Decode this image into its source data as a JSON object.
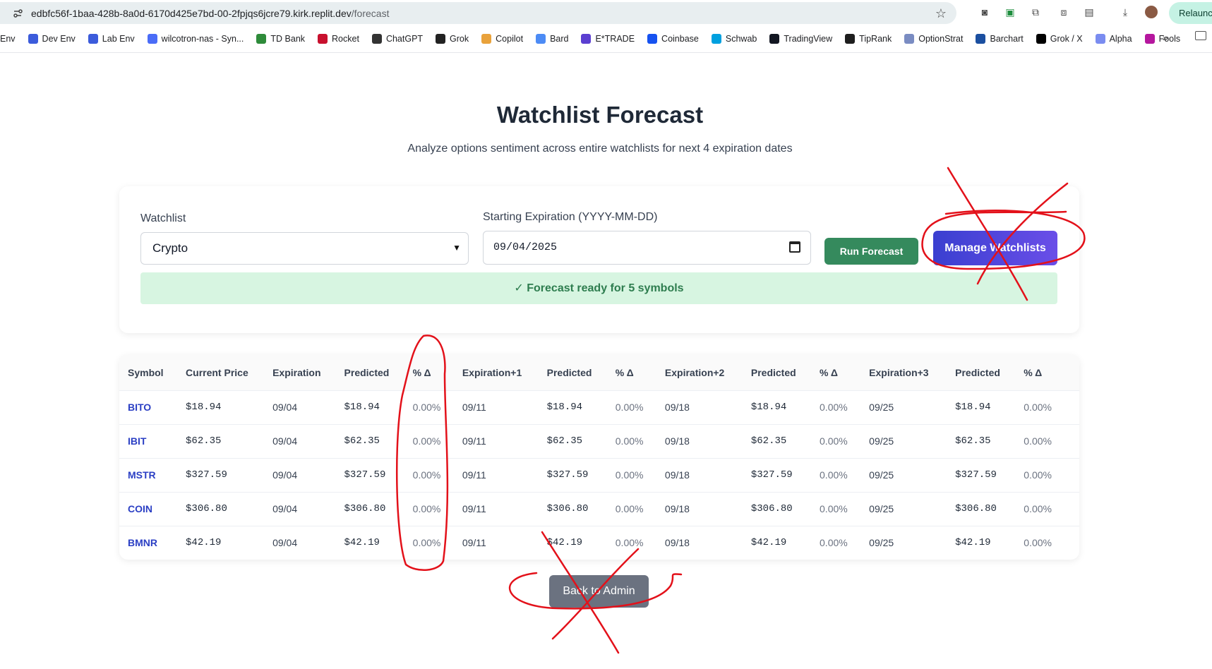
{
  "browser": {
    "url_host": "edbfc56f-1baa-428b-8a0d-6170d425e7bd-00-2fpjqs6jcre79.kirk.replit.dev",
    "url_path": "/forecast",
    "relaunch_label": "Relaunch"
  },
  "bookmarks": [
    {
      "label": "Env",
      "icon": "env-icon",
      "color": "#ffffff"
    },
    {
      "label": "Dev Env",
      "icon": "so-icon",
      "color": "#3b5bdb"
    },
    {
      "label": "Lab Env",
      "icon": "so-icon",
      "color": "#3b5bdb"
    },
    {
      "label": "wilcotron-nas - Syn...",
      "icon": "dsm-icon",
      "color": "#4a6cf7"
    },
    {
      "label": "TD Bank",
      "icon": "td-icon",
      "color": "#2e8b3a"
    },
    {
      "label": "Rocket",
      "icon": "rocket-icon",
      "color": "#c8102e"
    },
    {
      "label": "ChatGPT",
      "icon": "chatgpt-icon",
      "color": "#333333"
    },
    {
      "label": "Grok",
      "icon": "grok-icon",
      "color": "#222222"
    },
    {
      "label": "Copilot",
      "icon": "copilot-icon",
      "color": "#e9a23b"
    },
    {
      "label": "Bard",
      "icon": "bard-icon",
      "color": "#4c8bf5"
    },
    {
      "label": "E*TRADE",
      "icon": "etrade-icon",
      "color": "#5b3fd1"
    },
    {
      "label": "Coinbase",
      "icon": "coinbase-icon",
      "color": "#1652f0"
    },
    {
      "label": "Schwab",
      "icon": "schwab-icon",
      "color": "#00a0df"
    },
    {
      "label": "TradingView",
      "icon": "tradingview-icon",
      "color": "#131722"
    },
    {
      "label": "TipRank",
      "icon": "tiprank-icon",
      "color": "#1e1e1e"
    },
    {
      "label": "OptionStrat",
      "icon": "optionstrat-icon",
      "color": "#7a8cc2"
    },
    {
      "label": "Barchart",
      "icon": "barchart-icon",
      "color": "#1b4fa0"
    },
    {
      "label": "Grok / X",
      "icon": "x-icon",
      "color": "#000000"
    },
    {
      "label": "Alpha",
      "icon": "alpha-icon",
      "color": "#7a8cf0"
    },
    {
      "label": "Fools",
      "icon": "fools-icon",
      "color": "#b5179e"
    }
  ],
  "header": {
    "title": "Watchlist Forecast",
    "subtitle": "Analyze options sentiment across entire watchlists for next 4 expiration dates"
  },
  "form": {
    "watchlist_label": "Watchlist",
    "watchlist_value": "Crypto",
    "expiration_label": "Starting Expiration (YYYY-MM-DD)",
    "expiration_value": "09/04/2025",
    "run_button": "Run Forecast",
    "manage_button": "Manage Watchlists",
    "status": "✓ Forecast ready for 5 symbols"
  },
  "table": {
    "columns": [
      "Symbol",
      "Current Price",
      "Expiration",
      "Predicted",
      "% Δ",
      "Expiration+1",
      "Predicted",
      "% Δ",
      "Expiration+2",
      "Predicted",
      "% Δ",
      "Expiration+3",
      "Predicted",
      "% Δ"
    ],
    "rows": [
      [
        "BITO",
        "$18.94",
        "09/04",
        "$18.94",
        "0.00%",
        "09/11",
        "$18.94",
        "0.00%",
        "09/18",
        "$18.94",
        "0.00%",
        "09/25",
        "$18.94",
        "0.00%"
      ],
      [
        "IBIT",
        "$62.35",
        "09/04",
        "$62.35",
        "0.00%",
        "09/11",
        "$62.35",
        "0.00%",
        "09/18",
        "$62.35",
        "0.00%",
        "09/25",
        "$62.35",
        "0.00%"
      ],
      [
        "MSTR",
        "$327.59",
        "09/04",
        "$327.59",
        "0.00%",
        "09/11",
        "$327.59",
        "0.00%",
        "09/18",
        "$327.59",
        "0.00%",
        "09/25",
        "$327.59",
        "0.00%"
      ],
      [
        "COIN",
        "$306.80",
        "09/04",
        "$306.80",
        "0.00%",
        "09/11",
        "$306.80",
        "0.00%",
        "09/18",
        "$306.80",
        "0.00%",
        "09/25",
        "$306.80",
        "0.00%"
      ],
      [
        "BMNR",
        "$42.19",
        "09/04",
        "$42.19",
        "0.00%",
        "09/11",
        "$42.19",
        "0.00%",
        "09/18",
        "$42.19",
        "0.00%",
        "09/25",
        "$42.19",
        "0.00%"
      ]
    ]
  },
  "footer": {
    "back_button": "Back to Admin"
  },
  "colors": {
    "annotation": "#e3111a",
    "accent_green": "#358a5d",
    "accent_indigo": "#3a3fd0",
    "link_blue": "#2b3fc4"
  }
}
